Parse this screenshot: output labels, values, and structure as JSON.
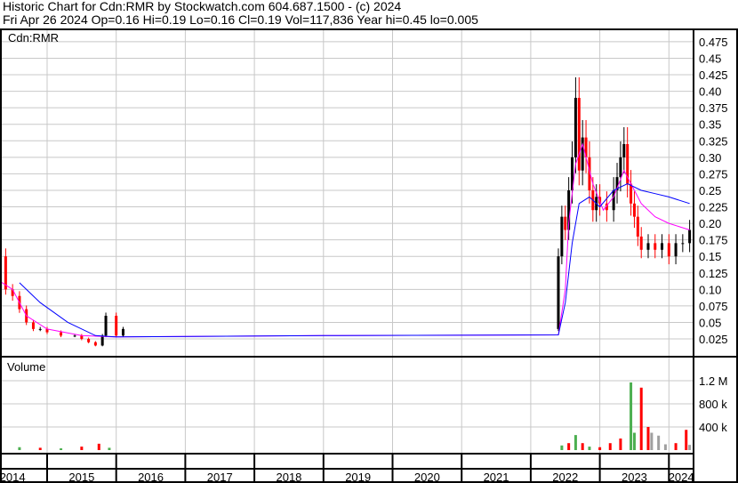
{
  "header": {
    "title": "Historic Chart for Cdn:RMR by Stockwatch.com 604.687.1500 - (c) 2024",
    "quote": "Fri Apr 26 2024  Op=0.16  Hi=0.19  Lo=0.16  Cl=0.19  Vol=117,836  Year hi=0.45  lo=0.005"
  },
  "colors": {
    "up": "#000000",
    "down": "#ff0000",
    "ma_short": "#ff00ff",
    "ma_long": "#0000ff",
    "vol_up": "#4caf50",
    "vol_down": "#ff0000",
    "vol_flat": "#a0a0a0",
    "grid": "#c8c8c8"
  },
  "chart_data": {
    "type": "candlestick",
    "symbol_label": "Cdn:RMR",
    "volume_label": "Volume",
    "price_ticks": [
      "0.475",
      "0.45",
      "0.425",
      "0.40",
      "0.375",
      "0.35",
      "0.325",
      "0.30",
      "0.275",
      "0.25",
      "0.225",
      "0.20",
      "0.175",
      "0.15",
      "0.125",
      "0.10",
      "0.075",
      "0.05",
      "0.025"
    ],
    "price_tick_values": [
      0.475,
      0.45,
      0.425,
      0.4,
      0.375,
      0.35,
      0.325,
      0.3,
      0.275,
      0.25,
      0.225,
      0.2,
      0.175,
      0.15,
      0.125,
      0.1,
      0.075,
      0.05,
      0.025
    ],
    "volume_ticks": [
      "1.2 M",
      "800 k",
      "400 k"
    ],
    "volume_tick_values": [
      1200000,
      800000,
      400000
    ],
    "years": [
      "2014",
      "2015",
      "2016",
      "2017",
      "2018",
      "2019",
      "2020",
      "2021",
      "2022",
      "2023",
      "2024"
    ],
    "price": [
      [
        2014.0,
        0.1
      ],
      [
        2014.1,
        0.14
      ],
      [
        2014.2,
        0.11
      ],
      [
        2014.3,
        0.15
      ],
      [
        2014.4,
        0.1
      ],
      [
        2014.5,
        0.09
      ],
      [
        2014.6,
        0.07
      ],
      [
        2014.7,
        0.05
      ],
      [
        2014.8,
        0.04
      ],
      [
        2014.9,
        0.04
      ],
      [
        2015.0,
        0.035
      ],
      [
        2015.2,
        0.03
      ],
      [
        2015.4,
        0.03
      ],
      [
        2015.5,
        0.025
      ],
      [
        2015.6,
        0.02
      ],
      [
        2015.7,
        0.015
      ],
      [
        2015.8,
        0.03
      ],
      [
        2015.85,
        0.06
      ],
      [
        2016.0,
        0.03
      ],
      [
        2016.1,
        0.04
      ],
      [
        2022.4,
        0.15
      ],
      [
        2022.45,
        0.21
      ],
      [
        2022.5,
        0.19
      ],
      [
        2022.55,
        0.25
      ],
      [
        2022.6,
        0.3
      ],
      [
        2022.65,
        0.39
      ],
      [
        2022.7,
        0.28
      ],
      [
        2022.75,
        0.33
      ],
      [
        2022.8,
        0.3
      ],
      [
        2022.85,
        0.25
      ],
      [
        2022.9,
        0.22
      ],
      [
        2022.95,
        0.24
      ],
      [
        2023.0,
        0.23
      ],
      [
        2023.1,
        0.22
      ],
      [
        2023.2,
        0.25
      ],
      [
        2023.25,
        0.27
      ],
      [
        2023.3,
        0.3
      ],
      [
        2023.35,
        0.32
      ],
      [
        2023.4,
        0.26
      ],
      [
        2023.45,
        0.23
      ],
      [
        2023.5,
        0.21
      ],
      [
        2023.55,
        0.18
      ],
      [
        2023.6,
        0.16
      ],
      [
        2023.7,
        0.17
      ],
      [
        2023.8,
        0.16
      ],
      [
        2023.9,
        0.17
      ],
      [
        2024.0,
        0.15
      ],
      [
        2024.1,
        0.17
      ],
      [
        2024.2,
        0.17
      ],
      [
        2024.3,
        0.19
      ]
    ],
    "ma_short": [
      [
        2014.2,
        0.12
      ],
      [
        2014.5,
        0.1
      ],
      [
        2014.7,
        0.06
      ],
      [
        2015.0,
        0.04
      ],
      [
        2015.5,
        0.03
      ],
      [
        2016.0,
        0.028
      ],
      [
        2019.0,
        0.03
      ],
      [
        2022.4,
        0.031
      ],
      [
        2022.5,
        0.1
      ],
      [
        2022.55,
        0.2
      ],
      [
        2022.65,
        0.29
      ],
      [
        2022.75,
        0.32
      ],
      [
        2022.9,
        0.26
      ],
      [
        2023.05,
        0.22
      ],
      [
        2023.2,
        0.24
      ],
      [
        2023.35,
        0.28
      ],
      [
        2023.5,
        0.25
      ],
      [
        2023.6,
        0.23
      ],
      [
        2023.8,
        0.21
      ],
      [
        2024.0,
        0.2
      ],
      [
        2024.3,
        0.19
      ]
    ],
    "ma_long": [
      [
        2014.6,
        0.11
      ],
      [
        2014.9,
        0.08
      ],
      [
        2015.3,
        0.05
      ],
      [
        2015.7,
        0.03
      ],
      [
        2016.0,
        0.028
      ],
      [
        2019.0,
        0.03
      ],
      [
        2022.4,
        0.031
      ],
      [
        2022.5,
        0.08
      ],
      [
        2022.6,
        0.17
      ],
      [
        2022.7,
        0.23
      ],
      [
        2022.85,
        0.24
      ],
      [
        2023.0,
        0.225
      ],
      [
        2023.2,
        0.25
      ],
      [
        2023.4,
        0.26
      ],
      [
        2023.6,
        0.25
      ],
      [
        2023.8,
        0.245
      ],
      [
        2024.0,
        0.24
      ],
      [
        2024.3,
        0.23
      ]
    ],
    "volume": [
      [
        2014.1,
        40000,
        "up"
      ],
      [
        2014.3,
        30000,
        "down"
      ],
      [
        2014.6,
        50000,
        "up"
      ],
      [
        2014.9,
        40000,
        "down"
      ],
      [
        2015.2,
        30000,
        "up"
      ],
      [
        2015.5,
        60000,
        "down"
      ],
      [
        2015.75,
        110000,
        "down"
      ],
      [
        2015.9,
        40000,
        "up"
      ],
      [
        2022.45,
        80000,
        "up"
      ],
      [
        2022.55,
        120000,
        "down"
      ],
      [
        2022.65,
        260000,
        "up"
      ],
      [
        2022.75,
        120000,
        "down"
      ],
      [
        2022.85,
        60000,
        "up"
      ],
      [
        2023.0,
        50000,
        "down"
      ],
      [
        2023.15,
        120000,
        "down"
      ],
      [
        2023.3,
        200000,
        "down"
      ],
      [
        2023.45,
        1170000,
        "up"
      ],
      [
        2023.5,
        300000,
        "up"
      ],
      [
        2023.6,
        1080000,
        "down"
      ],
      [
        2023.7,
        400000,
        "down"
      ],
      [
        2023.75,
        300000,
        "flat"
      ],
      [
        2023.85,
        250000,
        "flat"
      ],
      [
        2023.95,
        100000,
        "flat"
      ],
      [
        2024.1,
        120000,
        "down"
      ],
      [
        2024.25,
        350000,
        "down"
      ],
      [
        2024.3,
        90000,
        "flat"
      ]
    ],
    "ylim": [
      0,
      0.49
    ],
    "xlim": [
      2013.98,
      2024.35
    ]
  }
}
